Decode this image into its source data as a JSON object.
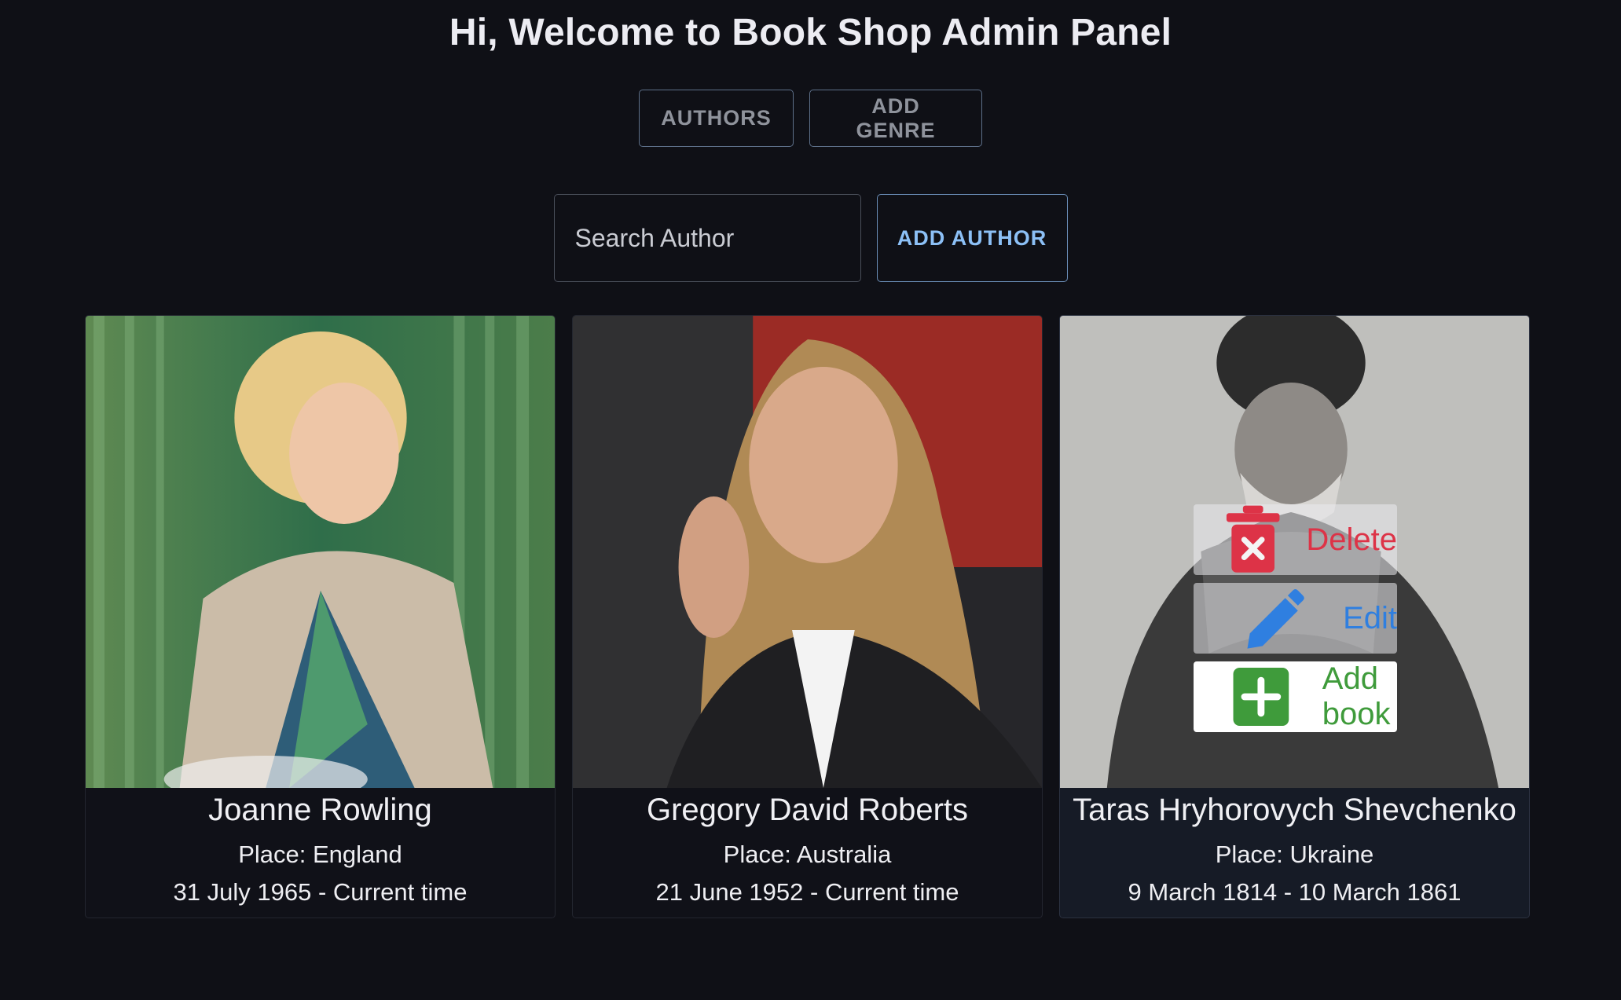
{
  "header": {
    "title": "Hi, Welcome to Book Shop Admin Panel"
  },
  "nav": {
    "authors_label": "AUTHORS",
    "add_genre_label": "ADD GENRE"
  },
  "toolbar": {
    "search_placeholder": "Search Author",
    "search_value": "",
    "add_author_label": "ADD AUTHOR"
  },
  "colors": {
    "background": "#0f1016",
    "accent_blue": "#8cc0f6",
    "delete_red": "#dd3347",
    "edit_blue": "#2f7fe0",
    "add_green": "#3f9b3b"
  },
  "authors": [
    {
      "name": "Joanne  Rowling",
      "place": "Place: England",
      "dates": "31 July 1965  -  Current time"
    },
    {
      "name": "Gregory David Roberts",
      "place": "Place: Australia",
      "dates": "21 June 1952  -  Current time"
    },
    {
      "name": "Taras Hryhorovych Shevchenko",
      "place": "Place: Ukraine",
      "dates": "9 March 1814  -  10 March 1861"
    }
  ],
  "card_actions": {
    "delete_label": "Delete",
    "edit_label": "Edit",
    "add_book_label": "Add book",
    "delete_icon": "trash-icon",
    "edit_icon": "pencil-icon",
    "add_book_icon": "plus-square-icon"
  }
}
